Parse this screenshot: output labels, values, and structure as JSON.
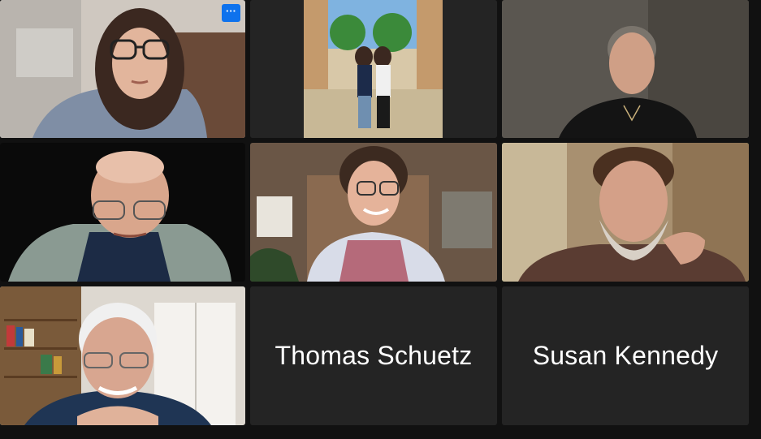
{
  "participants": [
    {
      "role": "video",
      "description_icon": "person-video"
    },
    {
      "role": "video",
      "description_icon": "photo-video"
    },
    {
      "role": "video",
      "description_icon": "person-video"
    },
    {
      "role": "video",
      "description_icon": "person-video"
    },
    {
      "role": "video",
      "description_icon": "person-video"
    },
    {
      "role": "video",
      "description_icon": "person-video",
      "active_speaker": true
    },
    {
      "role": "video",
      "description_icon": "person-video"
    },
    {
      "role": "name_only",
      "name": "Thomas Schuetz"
    },
    {
      "role": "name_only",
      "name": "Susan Kennedy"
    }
  ],
  "more_options": {
    "label": "···"
  },
  "colors": {
    "background": "#111111",
    "tile": "#242424",
    "active_speaker_border": "#2fd14a",
    "more_button": "#0e72ed"
  }
}
